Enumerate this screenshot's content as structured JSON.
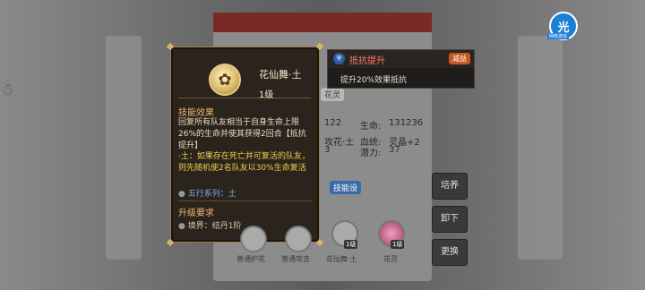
{
  "tooltip": {
    "skill_name": "花仙舞·土",
    "skill_level": "1级",
    "effect_title": "技能效果",
    "effect_desc": "回复所有队友相当于自身生命上限26%的生命并使其获得2回合【抵抗提升】",
    "extra_desc": "·土：如果存在死亡并可复活的队友，则先随机使2名队友以30%生命复活",
    "element_series": "五行系列：土",
    "upgrade_title": "升级要求",
    "upgrade_req": "境界：结丹1阶"
  },
  "buff": {
    "title": "抵抗提升",
    "badge": "减益",
    "desc": "提升20%效果抵抗"
  },
  "side_buttons": [
    "培养",
    "卸下",
    "更换"
  ],
  "stats": {
    "row1_left": "122",
    "row1_label": "生命:",
    "row1_value": "131236",
    "row2_left": "攻花·土",
    "row2_label": "血统:",
    "row2_value": "灵晶+2",
    "row3_left": "3",
    "row3_label": "潜力:",
    "row3_value": "37"
  },
  "bottom_skills": [
    {
      "label": "普通护花",
      "level": ""
    },
    {
      "label": "普通攻击",
      "level": ""
    },
    {
      "label": "花仙舞·土",
      "level": "1级"
    },
    {
      "label": "花灵",
      "level": "1级"
    }
  ],
  "logo": {
    "text": "光",
    "sub": "网络游戏"
  },
  "panel_chip": "花灵",
  "panel_button": "技能设",
  "colors": {
    "accent": "#f0b86a",
    "buff_red": "#ff7a6a",
    "badge_orange": "#c45a22"
  }
}
